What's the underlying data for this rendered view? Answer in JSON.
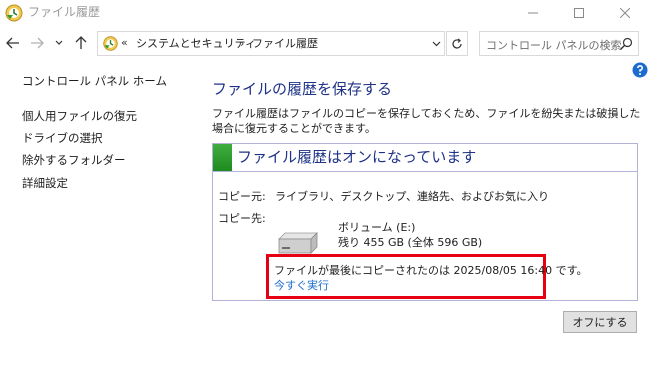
{
  "window": {
    "title": "ファイル履歴"
  },
  "nav": {
    "more": "«",
    "breadcrumbs": [
      "システムとセキュリティ",
      "ファイル履歴"
    ],
    "separator": "›",
    "search_placeholder": "コントロール パネルの検索"
  },
  "sidebar": {
    "items": [
      {
        "label": "コントロール パネル ホーム"
      },
      {
        "label": "個人用ファイルの復元"
      },
      {
        "label": "ドライブの選択"
      },
      {
        "label": "除外するフォルダー"
      },
      {
        "label": "詳細設定"
      }
    ]
  },
  "main": {
    "title": "ファイルの履歴を保存する",
    "description": "ファイル履歴はファイルのコピーを保存しておくため、ファイルを紛失または破損した場合に復元することができます。",
    "status": {
      "text": "ファイル履歴はオンになっています",
      "color": "#2e9b2e"
    },
    "source_label": "コピー元:",
    "source_value": "ライブラリ、デスクトップ、連絡先、およびお気に入り",
    "dest_label": "コピー先:",
    "volume_name": "ボリューム (E:)",
    "volume_space": "残り 455 GB (全体 596 GB)",
    "last_copy": "ファイルが最後にコピーされたのは 2025/08/05 16:40 です。",
    "run_now": "今すぐ実行",
    "turn_off": "オフにする"
  },
  "colors": {
    "title_blue": "#1e3287",
    "link_blue": "#1c6ccf",
    "highlight_red": "#e60012"
  }
}
